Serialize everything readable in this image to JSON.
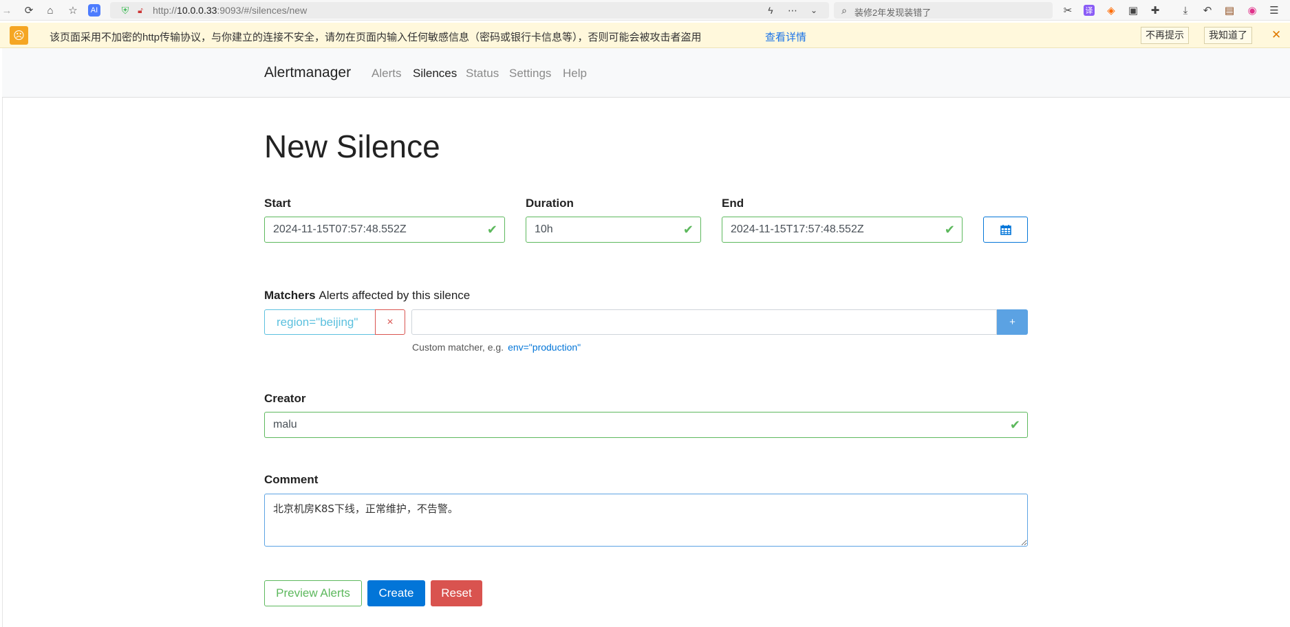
{
  "browser": {
    "url_prefix": "http://",
    "url_host": "10.0.0.33",
    "url_rest": ":9093/#/silences/new",
    "search_placeholder": "装修2年发现装错了"
  },
  "warning": {
    "text": "该页面采用不加密的http传输协议，与你建立的连接不安全，请勿在页面内输入任何敏感信息（密码或银行卡信息等），否则可能会被攻击者盗用",
    "details_link": "查看详情",
    "dont_remind": "不再提示",
    "got_it": "我知道了"
  },
  "nav": {
    "brand": "Alertmanager",
    "links": [
      "Alerts",
      "Silences",
      "Status",
      "Settings",
      "Help"
    ],
    "active": "Silences"
  },
  "page": {
    "title": "New Silence"
  },
  "form": {
    "start_label": "Start",
    "start_value": "2024-11-15T07:57:48.552Z",
    "duration_label": "Duration",
    "duration_value": "10h",
    "end_label": "End",
    "end_value": "2024-11-15T17:57:48.552Z",
    "matchers_label": "Matchers",
    "matchers_sublabel": "Alerts affected by this silence",
    "matchers": [
      "region=\"beijing\""
    ],
    "matcher_remove": "×",
    "matcher_add": "+",
    "matcher_input_value": "",
    "hint_text": "Custom matcher, e.g.",
    "hint_example": "env=\"production\"",
    "creator_label": "Creator",
    "creator_value": "malu",
    "comment_label": "Comment",
    "comment_value": "北京机房K8S下线，正常维护，不告警。"
  },
  "buttons": {
    "preview": "Preview Alerts",
    "create": "Create",
    "reset": "Reset"
  },
  "colors": {
    "valid": "#5cb85c",
    "primary": "#0275d8",
    "danger": "#d9534f",
    "info": "#5bc0de"
  }
}
